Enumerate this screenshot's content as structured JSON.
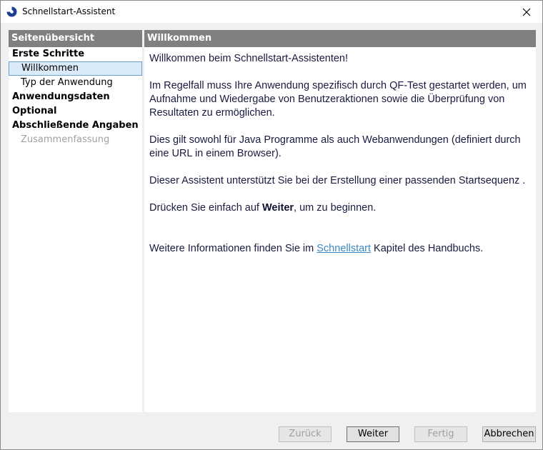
{
  "window": {
    "title": "Schnellstart-Assistent",
    "close_symbol": "×"
  },
  "sidebar": {
    "header": "Seitenübersicht",
    "items": [
      {
        "label": "Erste Schritte",
        "kind": "section"
      },
      {
        "label": "Willkommen",
        "kind": "sub",
        "selected": true
      },
      {
        "label": "Typ der Anwendung",
        "kind": "sub"
      },
      {
        "label": "Anwendungsdaten",
        "kind": "section"
      },
      {
        "label": "Optional",
        "kind": "section"
      },
      {
        "label": "Abschließende Angaben",
        "kind": "section"
      },
      {
        "label": "Zusammenfassung",
        "kind": "sub",
        "disabled": true
      }
    ]
  },
  "main": {
    "header": "Willkommen",
    "welcome": "Willkommen beim Schnellstart-Assistenten!",
    "para1": "Im Regelfall muss Ihre Anwendung spezifisch durch QF-Test gestartet werden, um Aufnahme und Wiedergabe von Benutzeraktionen sowie die Überprüfung von Resultaten zu ermöglichen.",
    "para2": "Dies gilt sowohl für Java Programme als auch Webanwendungen (definiert durch eine URL in einem Browser).",
    "para3": "Dieser Assistent unterstützt Sie bei der Erstellung einer passenden Startsequenz .",
    "para4_before": "Drücken Sie einfach auf ",
    "para4_bold": "Weiter",
    "para4_after": ", um zu beginnen.",
    "para5_before": "Weitere Informationen finden Sie im ",
    "para5_link": "Schnellstart",
    "para5_after": " Kapitel des Handbuchs."
  },
  "buttons": {
    "back": "Zurück",
    "next": "Weiter",
    "finish": "Fertig",
    "cancel": "Abbrechen"
  },
  "colors": {
    "header_bg": "#808080",
    "selection_bg": "#dbeaf9",
    "selection_border": "#6a9fd4",
    "link": "#3b8ac4"
  }
}
